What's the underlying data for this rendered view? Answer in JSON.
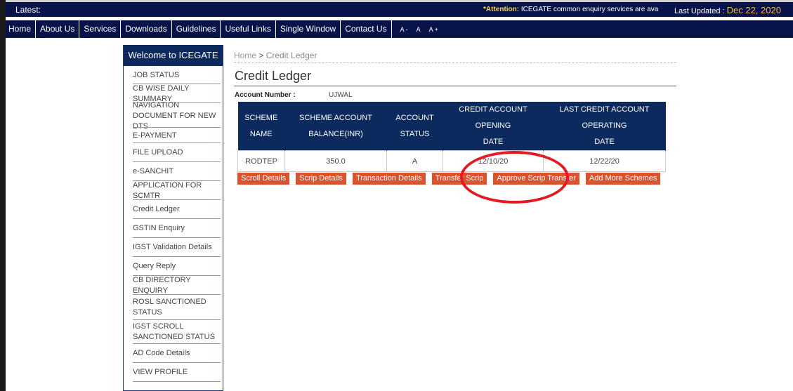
{
  "ticker": {
    "latest": "Latest:",
    "attention_label": "*Attention:",
    "attention_text": " ICEGATE common enquiry services are avail",
    "updated_label": "Last Updated : ",
    "updated_date": "Dec 22, 2020"
  },
  "nav": {
    "items": [
      "Home",
      "About Us",
      "Services",
      "Downloads",
      "Guidelines",
      "Useful Links",
      "Single Window",
      "Contact Us"
    ],
    "font_controls": [
      "A-",
      "A",
      "A+"
    ]
  },
  "sidebar": {
    "title": "Welcome to ICEGATE",
    "items": [
      "JOB STATUS",
      "CB WISE DAILY SUMMARY",
      "NAVIGATION DOCUMENT FOR NEW DTS",
      "E-PAYMENT",
      "FILE UPLOAD",
      "e-SANCHIT",
      "APPLICATION FOR SCMTR",
      "Credit Ledger",
      "GSTIN Enquiry",
      "IGST Validation Details",
      "Query Reply",
      "CB DIRECTORY ENQUIRY",
      "ROSL SANCTIONED STATUS",
      "IGST SCROLL SANCTIONED STATUS",
      "AD Code Details",
      "VIEW PROFILE"
    ]
  },
  "breadcrumb": {
    "home": "Home",
    "sep": " > ",
    "current": "Credit Ledger"
  },
  "page_title": "Credit Ledger",
  "account": {
    "label": "Account Number :",
    "value": "UJWAL"
  },
  "table": {
    "headers": [
      [
        "SCHEME",
        "NAME"
      ],
      [
        "SCHEME ACCOUNT",
        "BALANCE(INR)"
      ],
      [
        "ACCOUNT",
        "STATUS"
      ],
      [
        "CREDIT ACCOUNT OPENING",
        "DATE"
      ],
      [
        "LAST CREDIT ACCOUNT OPERATING",
        "DATE"
      ]
    ],
    "rows": [
      [
        "RODTEP",
        "350.0",
        "A",
        "12/10/20",
        "12/22/20"
      ]
    ]
  },
  "buttons": [
    "Scroll Details",
    "Scrip Details",
    "Transaction Details",
    "Transfer Scrip",
    "Approve Scrip Transfer",
    "Add More Schemes"
  ],
  "colors": {
    "navy": "#081449",
    "button": "#d9532c",
    "annotation": "#e21b23"
  }
}
